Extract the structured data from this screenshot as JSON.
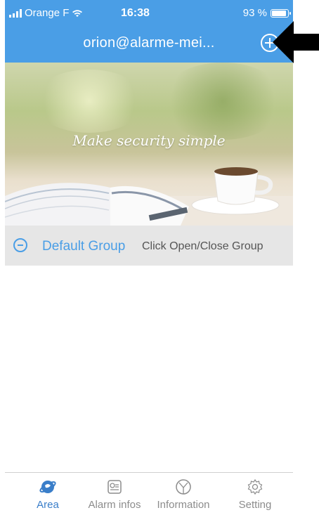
{
  "status_bar": {
    "carrier": "Orange F",
    "time": "16:38",
    "battery": "93 %",
    "battery_level": 0.93
  },
  "header": {
    "title": "orion@alarme-mei...",
    "add_icon": "plus-circle-icon"
  },
  "banner": {
    "slogan": "Make security simple"
  },
  "group": {
    "name": "Default Group",
    "hint": "Click Open/Close Group",
    "toggle_icon": "minus-circle-icon"
  },
  "tabs": [
    {
      "label": "Area",
      "icon": "globe-icon",
      "active": true
    },
    {
      "label": "Alarm infos",
      "icon": "alarm-list-icon",
      "active": false
    },
    {
      "label": "Information",
      "icon": "information-icon",
      "active": false
    },
    {
      "label": "Setting",
      "icon": "gear-icon",
      "active": false
    }
  ],
  "colors": {
    "accent": "#4a9ee6",
    "active_tab": "#3a7ec9",
    "inactive_tab": "#8c8c8c",
    "group_row_bg": "#e6e6e6"
  }
}
